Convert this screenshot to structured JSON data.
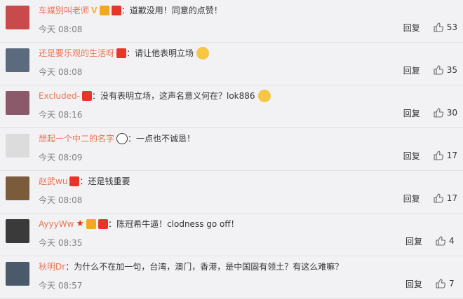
{
  "comments": [
    {
      "name": "车媒别叫老师",
      "content": "道歉没用！同意的点赞！",
      "time": "今天 08:08",
      "reply": "回复",
      "likes": "53",
      "badges": [
        "v",
        "coin",
        "medal"
      ],
      "emoji": false,
      "avatar_color": "#c94a4a"
    },
    {
      "name": "还是要乐观的生活呀",
      "content": "请让他表明立场",
      "time": "今天 08:08",
      "reply": "回复",
      "likes": "35",
      "badges": [
        "medal"
      ],
      "emoji": true,
      "avatar_color": "#5b6b7d"
    },
    {
      "name": "Excluded-",
      "content": "没有表明立场，这声名意义何在？lok886",
      "time": "今天 08:16",
      "reply": "回复",
      "likes": "30",
      "badges": [
        "medal"
      ],
      "emoji": true,
      "avatar_color": "#8a5a6a"
    },
    {
      "name": "想起一个中二的名字",
      "content": "一点也不诚恳！",
      "time": "今天 08:09",
      "reply": "回复",
      "likes": "17",
      "badges": [
        "panda"
      ],
      "emoji": false,
      "avatar_color": "#dcdcdc"
    },
    {
      "name": "赵武wu",
      "content": "还是钱重要",
      "time": "今天 08:08",
      "reply": "回复",
      "likes": "17",
      "badges": [
        "medal"
      ],
      "emoji": false,
      "avatar_color": "#7a5c3a"
    },
    {
      "name": "AyyyWw",
      "content": "陈冠希牛逼！clodness go off！",
      "time": "今天 08:35",
      "reply": "回复",
      "likes": "4",
      "badges": [
        "star",
        "coin",
        "medal"
      ],
      "emoji": false,
      "avatar_color": "#3a3a3a"
    },
    {
      "name": "秋明Dr",
      "content": "为什么不在加一句，台湾，澳门，香港，是中国固有领土？有这么难嘛？",
      "time": "今天 08:57",
      "reply": "回复",
      "likes": "7",
      "badges": [],
      "emoji": false,
      "avatar_color": "#4a5a6a"
    }
  ],
  "colors": {
    "name": "#eb7350",
    "text": "#333333",
    "time": "#808080",
    "background": "#f2f2f5",
    "medal": "#e8352a",
    "coin": "#f5a623"
  }
}
